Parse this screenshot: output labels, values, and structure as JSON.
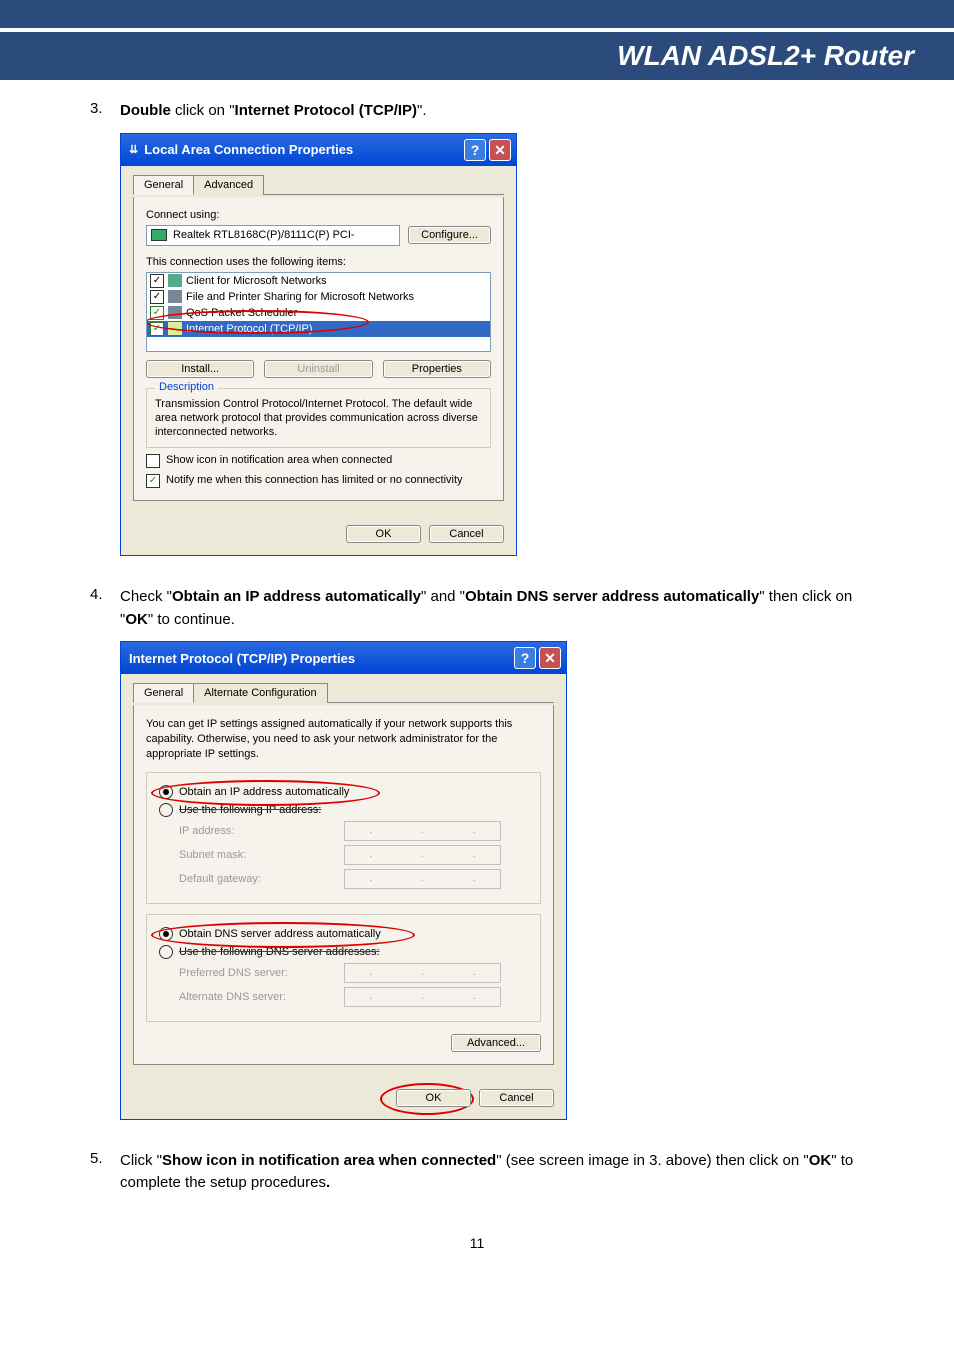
{
  "header": {
    "title": "WLAN ADSL2+ Router"
  },
  "steps": {
    "s3": {
      "num": "3.",
      "pre": "Double",
      "mid": " click on \"",
      "bold": "Internet Protocol (TCP/IP)",
      "post": "\"."
    },
    "s4": {
      "num": "4.",
      "t1": "Check \"",
      "b1": "Obtain an IP address automatically",
      "t2": "\" and \"",
      "b2": "Obtain DNS server address automatically",
      "t3": "\" then click on \"",
      "b3": "OK",
      "t4": "\" to continue."
    },
    "s5": {
      "num": "5.",
      "t1": "Click \"",
      "b1": "Show icon in notification area when connected",
      "t2": "\" (see screen image in 3. above) then click on \"",
      "b2": "OK",
      "t3": "\" to complete the setup procedures",
      "b3": "."
    }
  },
  "dialog1": {
    "title": "Local Area Connection Properties",
    "tabs": {
      "general": "General",
      "advanced": "Advanced"
    },
    "connect_using": "Connect using:",
    "adapter": "Realtek RTL8168C(P)/8111C(P) PCI-",
    "configure": "Configure...",
    "uses_label": "This connection uses the following items:",
    "items": {
      "i1": "Client for Microsoft Networks",
      "i2": "File and Printer Sharing for Microsoft Networks",
      "i3": "QoS Packet Scheduler",
      "i4": "Internet Protocol (TCP/IP)"
    },
    "install": "Install...",
    "uninstall": "Uninstall",
    "properties": "Properties",
    "desc_title": "Description",
    "desc_body": "Transmission Control Protocol/Internet Protocol. The default wide area network protocol that provides communication across diverse interconnected networks.",
    "chk1": "Show icon in notification area when connected",
    "chk2": "Notify me when this connection has limited or no connectivity",
    "ok": "OK",
    "cancel": "Cancel"
  },
  "dialog2": {
    "title": "Internet Protocol (TCP/IP) Properties",
    "tabs": {
      "general": "General",
      "alt": "Alternate Configuration"
    },
    "intro": "You can get IP settings assigned automatically if your network supports this capability. Otherwise, you need to ask your network administrator for the appropriate IP settings.",
    "r_ip_auto": "Obtain an IP address automatically",
    "r_ip_manual": "Use the following IP address:",
    "ip_address": "IP address:",
    "subnet": "Subnet mask:",
    "gateway": "Default gateway:",
    "r_dns_auto": "Obtain DNS server address automatically",
    "r_dns_manual": "Use the following DNS server addresses:",
    "pref_dns": "Preferred DNS server:",
    "alt_dns": "Alternate DNS server:",
    "advanced": "Advanced...",
    "ok": "OK",
    "cancel": "Cancel"
  },
  "page_number": "11"
}
